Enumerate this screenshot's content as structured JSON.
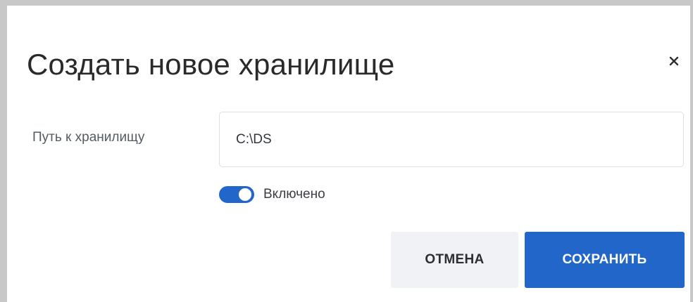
{
  "dialog": {
    "title": "Создать новое хранилище",
    "close_icon": "close-icon"
  },
  "form": {
    "path_label": "Путь к хранилищу",
    "path_value": "C:\\DS",
    "enabled_toggle": {
      "state": true,
      "label": "Включено"
    }
  },
  "actions": {
    "cancel_label": "ОТМЕНА",
    "save_label": "СОХРАНИТЬ"
  },
  "colors": {
    "accent": "#2366c9",
    "cancel_bg": "#f1f2f5",
    "title_text": "#2a2a2a"
  }
}
